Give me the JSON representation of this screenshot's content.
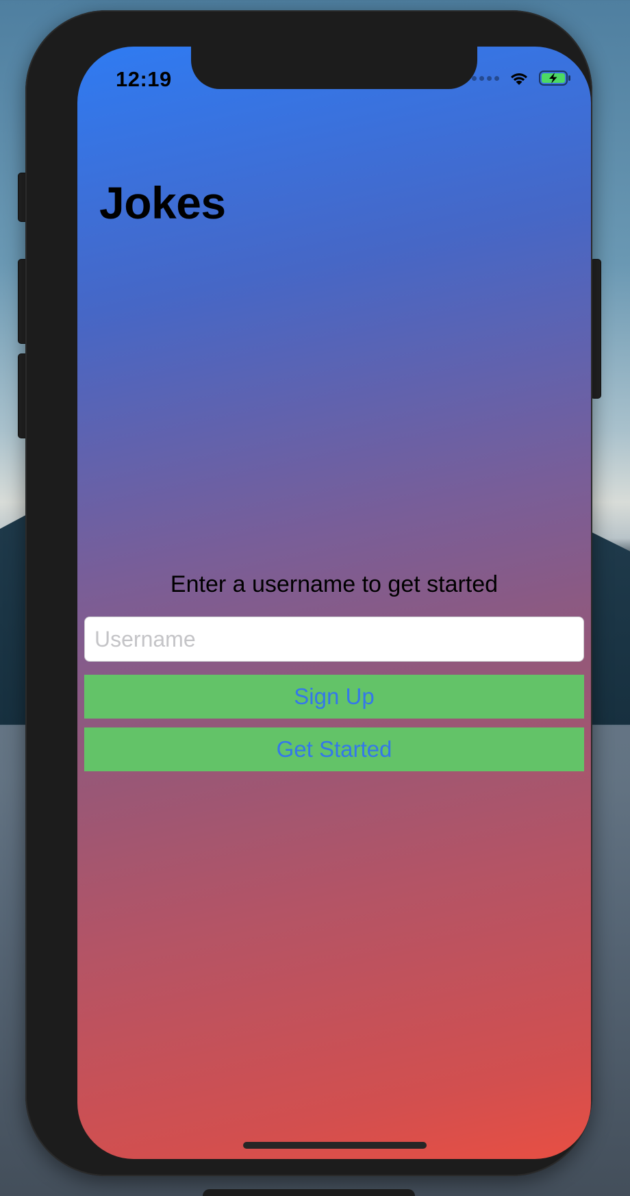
{
  "status_bar": {
    "time": "12:19",
    "icons": [
      "cellular-signal-icon",
      "wifi-icon",
      "battery-charging-icon"
    ]
  },
  "screen": {
    "title": "Jokes",
    "prompt": "Enter a username to get started",
    "username_input": {
      "placeholder": "Username",
      "value": ""
    },
    "buttons": {
      "sign_up": "Sign Up",
      "get_started": "Get Started"
    }
  },
  "colors": {
    "gradient_top": "#2f7bf2",
    "gradient_bottom": "#e84f43",
    "button_background": "#63c368",
    "button_text": "#3477ea"
  }
}
